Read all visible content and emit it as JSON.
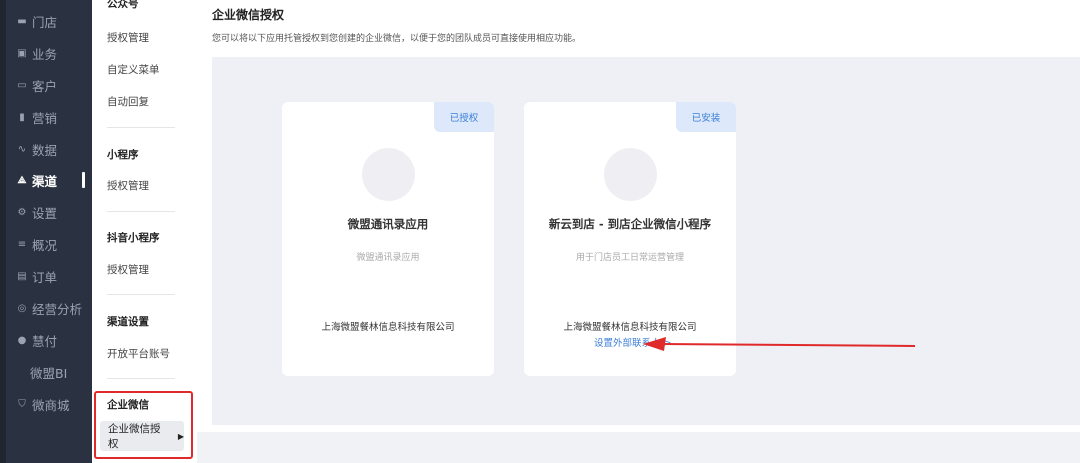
{
  "nav": {
    "items": [
      {
        "label": "门店",
        "icon": "store-icon",
        "glyph": "▬"
      },
      {
        "label": "业务",
        "icon": "briefcase-icon",
        "glyph": "▣"
      },
      {
        "label": "客户",
        "icon": "customer-icon",
        "glyph": "▭"
      },
      {
        "label": "营销",
        "icon": "marketing-icon",
        "glyph": "▮"
      },
      {
        "label": "数据",
        "icon": "chart-line-icon",
        "glyph": "∿"
      },
      {
        "label": "渠道",
        "icon": "channel-icon",
        "glyph": "⟁"
      },
      {
        "label": "设置",
        "icon": "gear-icon",
        "glyph": "⚙"
      },
      {
        "label": "概况",
        "icon": "overview-icon",
        "glyph": "≡"
      },
      {
        "label": "订单",
        "icon": "order-icon",
        "glyph": "▤"
      },
      {
        "label": "经营分析",
        "icon": "analysis-icon",
        "glyph": "◎"
      },
      {
        "label": "慧付",
        "icon": "pay-icon",
        "glyph": "●"
      },
      {
        "label": "微盟BI",
        "icon": "",
        "glyph": ""
      },
      {
        "label": "微商城",
        "icon": "shop-icon",
        "glyph": "⛉"
      }
    ],
    "active_index": 5
  },
  "subnav": {
    "gzh_title": "公众号",
    "gzh_auth": "授权管理",
    "gzh_menu": "自定义菜单",
    "gzh_reply": "自动回复",
    "mini_title": "小程序",
    "mini_auth": "授权管理",
    "douyin_title": "抖音小程序",
    "douyin_auth": "授权管理",
    "channel_title": "渠道设置",
    "channel_open": "开放平台账号",
    "wework_title": "企业微信",
    "wework_auth": "企业微信授权"
  },
  "main": {
    "title": "企业微信授权",
    "description": "您可以将以下应用托管授权到您创建的企业微信，以便于您的团队成员可直接使用相应功能。"
  },
  "cards": [
    {
      "badge": "已授权",
      "title": "微盟通讯录应用",
      "desc": "微盟通讯录应用",
      "company": "上海微盟餐林信息科技有限公司",
      "link": ""
    },
    {
      "badge": "已安装",
      "title": "新云到店 - 到店企业微信小程序",
      "desc": "用于门店员工日常运营管理",
      "company": "上海微盟餐林信息科技有限公司",
      "link": "设置外部联系人 >"
    }
  ],
  "colors": {
    "nav_bg": "#2a3140",
    "accent": "#3d7fd8",
    "badge_bg": "#dde9fa",
    "highlight_red": "#e0292b"
  }
}
